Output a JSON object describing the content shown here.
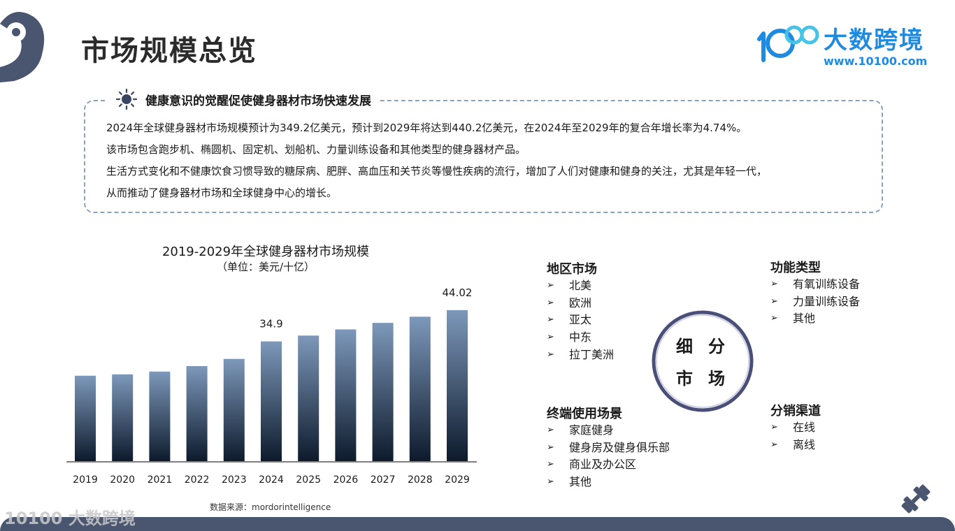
{
  "page": {
    "title": "市场规模总览"
  },
  "brand": {
    "name": "大数跨境",
    "url": "www.10100.com",
    "watermark": "10100 大数跨境",
    "colors": {
      "primary": "#1e8be0",
      "logo_secondary": "#47c3e8"
    }
  },
  "highlight": {
    "icon": "sun-icon",
    "title": "健康意识的觉醒促使健身器材市场快速发展",
    "paragraphs": [
      "2024年全球健身器材市场规模预计为349.2亿美元，预计到2029年将达到440.2亿美元，在2024年至2029年的复合年增长率为4.74%。",
      "该市场包含跑步机、椭圆机、固定机、划船机、力量训练设备和其他类型的健身器材产品。",
      "生活方式变化和不健康饮食习惯导致的糖尿病、肥胖、高血压和关节炎等慢性疾病的流行，增加了人们对健康和健身的关注，尤其是年轻一代，",
      "从而推动了健身器材市场和全球健身中心的增长。"
    ]
  },
  "chart_data": {
    "type": "bar",
    "title": "2019-2029年全球健身器材市场规模",
    "subtitle": "（单位：美元/十亿）",
    "categories": [
      "2019",
      "2020",
      "2021",
      "2022",
      "2023",
      "2024",
      "2025",
      "2026",
      "2027",
      "2028",
      "2029"
    ],
    "values": [
      24.9,
      25.3,
      26.1,
      27.7,
      29.8,
      34.9,
      36.6,
      38.4,
      40.3,
      42.1,
      44.02
    ],
    "data_labels": {
      "2024": "34.9",
      "2029": "44.02"
    },
    "ylim": [
      0,
      50
    ],
    "grid": false,
    "colors": {
      "bar_top": "#7d98ba",
      "bar_bottom": "#0d1a2c"
    },
    "source": "数据来源：mordorintelligence"
  },
  "segments": {
    "center": {
      "line1": "细分",
      "line2": "市场",
      "ring_color": "#4a4f78"
    },
    "region": {
      "title": "地区市场",
      "items": [
        "北美",
        "欧洲",
        "亚太",
        "中东",
        "拉丁美洲"
      ]
    },
    "function": {
      "title": "功能类型",
      "items": [
        "有氧训练设备",
        "力量训练设备",
        "其他"
      ]
    },
    "end_use": {
      "title": "终端使用场景",
      "items": [
        "家庭健身",
        "健身房及健身俱乐部",
        "商业及办公区",
        "其他"
      ]
    },
    "channel": {
      "title": "分销渠道",
      "items": [
        "在线",
        "离线"
      ]
    },
    "bullet": "➢"
  },
  "theme": {
    "navy": "#4a5670",
    "dashed_border": "#8aa0bd"
  }
}
